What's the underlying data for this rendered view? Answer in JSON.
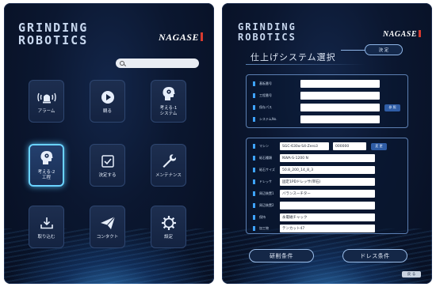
{
  "left": {
    "logo_line1": "GRINDING",
    "logo_line2": "ROBOTICS",
    "brand": "NAGASE",
    "search": {
      "placeholder": "",
      "value": ""
    },
    "tiles": [
      {
        "label": "アラーム",
        "icon": "alarm-light-icon"
      },
      {
        "label": "観る",
        "icon": "play-icon"
      },
      {
        "label": "考える-1\nシステム",
        "icon": "brain-head-icon"
      },
      {
        "label": "考える-2\n工程",
        "icon": "brain-head-icon",
        "active": true
      },
      {
        "label": "決定する",
        "icon": "checkbox-icon"
      },
      {
        "label": "メンテナンス",
        "icon": "wrench-icon"
      },
      {
        "label": "取り込む",
        "icon": "download-icon"
      },
      {
        "label": "コンタクト",
        "icon": "paper-plane-icon"
      },
      {
        "label": "設定",
        "icon": "gear-icon"
      }
    ],
    "colors": {
      "accent": "#6ad3ff",
      "background": "#0b1730"
    }
  },
  "right": {
    "logo_line1": "GRINDING",
    "logo_line2": "ROBOTICS",
    "brand": "NAGASE",
    "title": "仕上げシステム選択",
    "decide_label": "決 定",
    "top_form": {
      "rows": [
        {
          "label": "基板番号",
          "value": ""
        },
        {
          "label": "工程番号",
          "value": ""
        },
        {
          "label": "保存パス",
          "value": ""
        },
        {
          "label": "システムNo.",
          "value": ""
        }
      ],
      "browse_label": "参 照"
    },
    "bottom_form": {
      "machine_label": "マシン",
      "machine_value": "SGC-630α-S4-Zero3",
      "machine_value2": "000000",
      "machine_btn": "変 更",
      "rows": [
        {
          "label": "砥石種類",
          "value": "NWA-S-1200 N"
        },
        {
          "label": "砥石サイズ",
          "value": "50.8_200_14_8_3"
        },
        {
          "label": "ドレッサ",
          "value": "固定1PDドレッサ(単石)"
        },
        {
          "label": "周辺装置1",
          "value": "バランスーチター"
        },
        {
          "label": "周辺装置2",
          "value": ""
        },
        {
          "label": "保持",
          "value": "永電磁チャック"
        },
        {
          "label": "加工物",
          "value": "テンカット47"
        }
      ]
    },
    "grind_condition_label": "研削条件",
    "dress_condition_label": "ドレス条件",
    "back_label": "戻 る"
  }
}
